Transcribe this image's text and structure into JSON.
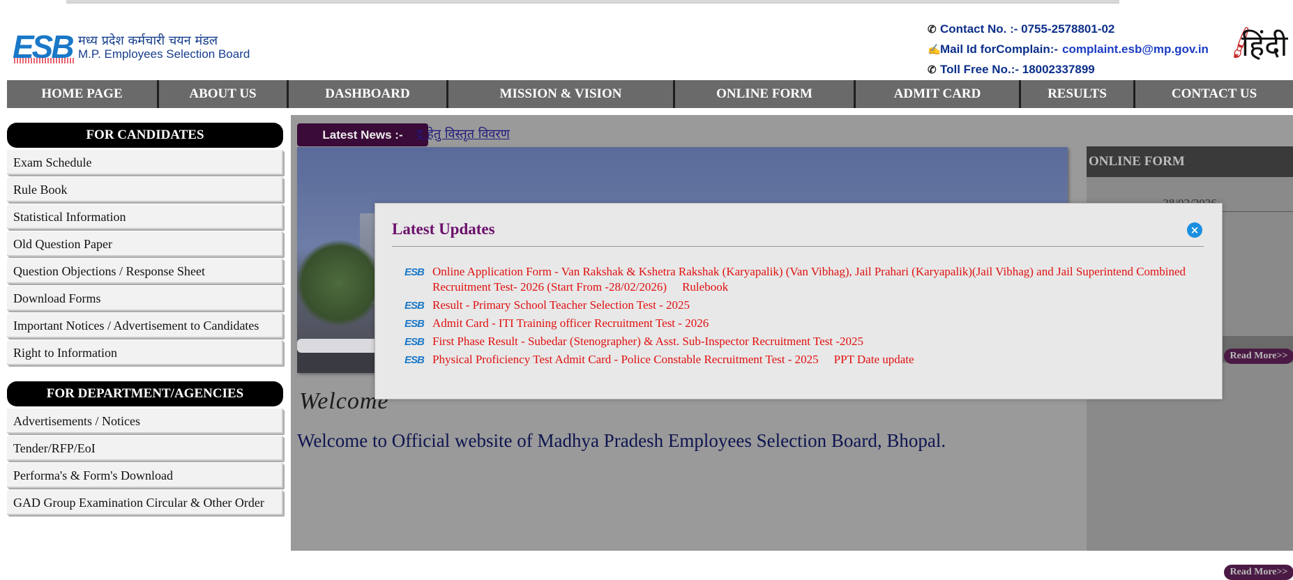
{
  "header": {
    "logo_mark": "ESB",
    "logo_hindi": "मध्य प्रदेश कर्मचारी चयन मंडल",
    "logo_english": "M.P. Employees Selection Board",
    "contact_label": "Contact No. :- 0755-2578801-02",
    "mail_label": "Mail Id forComplain:-",
    "mail_value": "complaint.esb@mp.gov.in",
    "tollfree_label": "Toll Free No.:- 18002337899",
    "language_toggle": "हिंदी"
  },
  "nav": {
    "items": [
      "HOME PAGE",
      "ABOUT US",
      "DASHBOARD",
      "MISSION & VISION",
      "ONLINE FORM",
      "ADMIT CARD",
      "RESULTS",
      "CONTACT US"
    ]
  },
  "sidebar": {
    "candidates_title": "FOR CANDIDATES",
    "candidates": [
      "Exam Schedule",
      "Rule Book",
      "Statistical Information",
      "Old Question Paper",
      "Question Objections / Response Sheet",
      "Download Forms",
      "Important Notices / Advertisement to Candidates",
      "Right to Information"
    ],
    "department_title": "FOR DEPARTMENT/AGENCIES",
    "department": [
      "Advertisements / Notices",
      "Tender/RFP/EoI",
      "Performa's & Form's Download",
      "GAD Group Examination Circular & Other Order"
    ]
  },
  "main": {
    "news_label": "Latest News :-",
    "news_text": "द हेतु विस्तृत विवरण",
    "welcome_script": "Welcome",
    "welcome_text": "Welcome to Official website of Madhya Pradesh Employees Selection Board, Bhopal.",
    "online_form_title": "ONLINE FORM",
    "online_form_date": "28/02/2026",
    "read_more": "Read More>>"
  },
  "modal": {
    "title": "Latest Updates",
    "close_glyph": "×",
    "badge": "ESB",
    "updates": [
      {
        "text": "Online Application Form - Van Rakshak & Kshetra Rakshak (Karyapalik) (Van Vibhag), Jail Prahari (Karyapalik)(Jail Vibhag) and Jail Superintend Combined Recruitment Test- 2026 (Start From -28/02/2026)",
        "extra": "Rulebook"
      },
      {
        "text": "Result - Primary School Teacher Selection Test - 2025",
        "extra": ""
      },
      {
        "text": "Admit Card - ITI Training officer Recruitment Test - 2026",
        "extra": ""
      },
      {
        "text": "First Phase Result - Subedar (Stenographer) & Asst. Sub-Inspector Recruitment Test -2025",
        "extra": ""
      },
      {
        "text": "Physical Proficiency Test Admit Card - Police Constable Recruitment Test - 2025",
        "extra": "PPT Date update"
      }
    ]
  },
  "colors": {
    "nav_bg": "#6a6a6a",
    "modal_title": "#6b0f6b",
    "update_link": "#e01010",
    "brand_blue": "#1a78c8"
  }
}
